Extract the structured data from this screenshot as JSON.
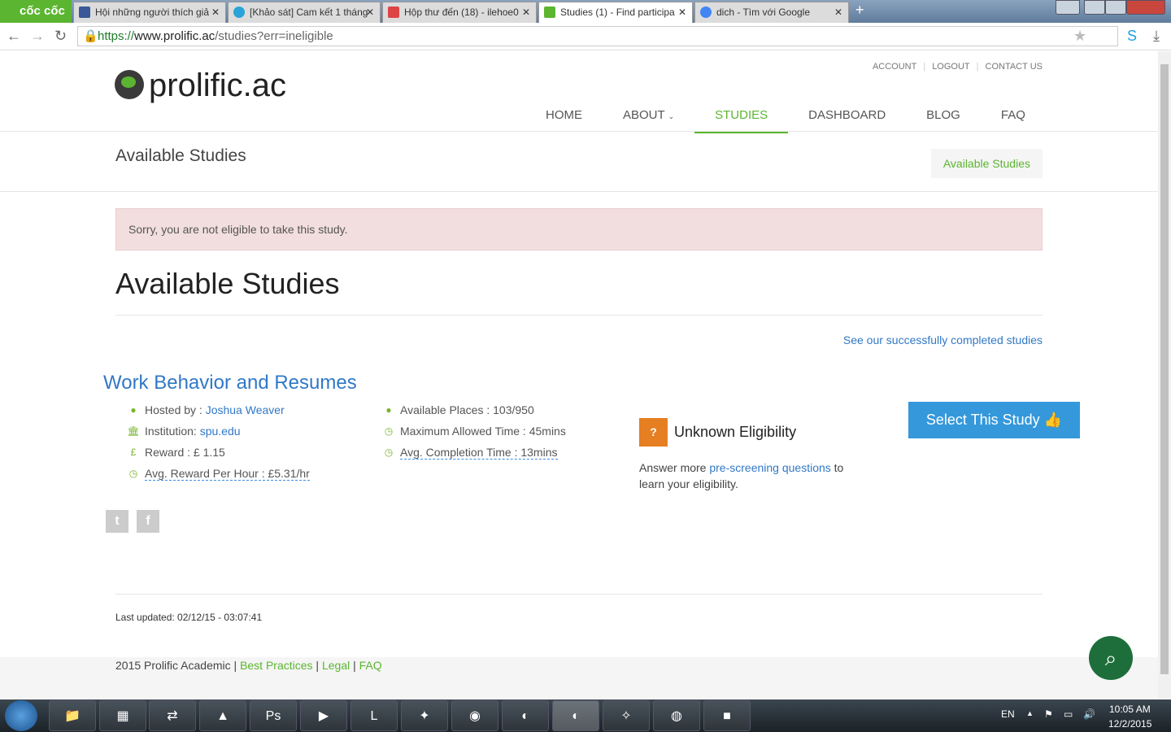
{
  "browser": {
    "brand": "cốc cốc",
    "tabs": [
      {
        "title": "Hội những người thích giả",
        "icon": "facebook-icon",
        "color": "#3b5998"
      },
      {
        "title": "[Khảo sát] Cam kết 1 tháng",
        "icon": "survey-icon",
        "color": "#2aa3d8"
      },
      {
        "title": "Hộp thư đến (18) - ilehoe0",
        "icon": "gmail-icon",
        "color": "#d44"
      },
      {
        "title": "Studies (1) - Find participa",
        "icon": "prolific-icon",
        "color": "#5bb530",
        "active": true
      },
      {
        "title": "dich - Tìm với Google",
        "icon": "google-icon",
        "color": "#4285f4"
      }
    ],
    "url_scheme": "https://",
    "url_domain": "www.prolific.ac",
    "url_path": "/studies?err=ineligible"
  },
  "site": {
    "logo": "prolific.ac",
    "top_links": [
      "ACCOUNT",
      "LOGOUT",
      "CONTACT US"
    ],
    "nav": [
      "HOME",
      "ABOUT",
      "STUDIES",
      "DASHBOARD",
      "BLOG",
      "FAQ"
    ],
    "active_nav": "STUDIES",
    "accent": "#5bb530",
    "link": "#3178c6"
  },
  "header": {
    "title": "Available Studies",
    "breadcrumb": "Available Studies"
  },
  "alert": "Sorry, you are not eligible to take this study.",
  "main": {
    "title": "Available Studies",
    "see_completed": "See our successfully completed studies"
  },
  "study": {
    "title": "Work Behavior and Resumes",
    "hosted_label": "Hosted by : ",
    "hosted_by": "Joshua Weaver",
    "institution_label": "Institution: ",
    "institution": "spu.edu",
    "reward": "Reward : £ 1.15",
    "avg_reward": "Avg. Reward Per Hour : £5.31/hr",
    "places": "Available Places : 103/950",
    "max_time": "Maximum Allowed Time : 45mins",
    "avg_time": "Avg. Completion Time : 13mins",
    "eligibility": "Unknown Eligibility",
    "elig_pre": "Answer more ",
    "elig_link": "pre-screening questions",
    "elig_post": " to learn your eligibility.",
    "select": "Select This Study"
  },
  "updated": "Last updated: 02/12/15 - 03:07:41",
  "footer": {
    "copy": "2015 Prolific Academic",
    "links": [
      "Best Practices",
      "Legal",
      "FAQ"
    ]
  },
  "taskbar": {
    "lang": "EN",
    "time": "10:05 AM",
    "date": "12/2/2015"
  }
}
